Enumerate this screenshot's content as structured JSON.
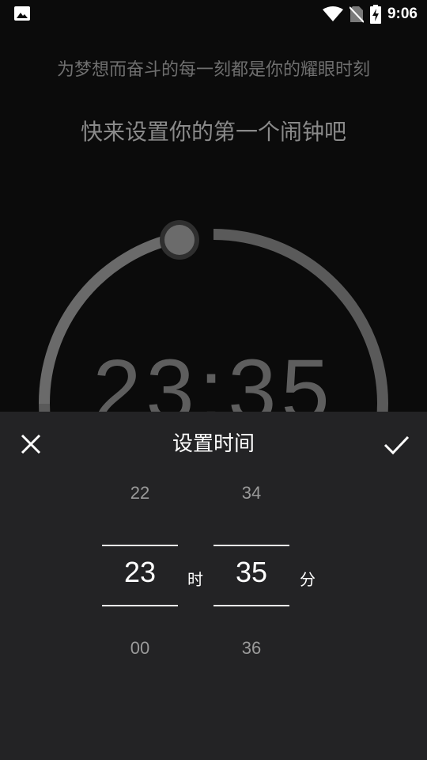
{
  "status_bar": {
    "time": "9:06",
    "icons": [
      "image-icon",
      "wifi-icon",
      "no-sim-icon",
      "battery-charging-icon"
    ]
  },
  "header": {
    "slogan": "为梦想而奋斗的每一刻都是你的耀眼时刻",
    "prompt": "快来设置你的第一个闹钟吧"
  },
  "clock_display": {
    "time": "23:35"
  },
  "time_sheet": {
    "title": "设置时间",
    "close_icon": "close-icon",
    "confirm_icon": "check-icon",
    "hour": {
      "above": "22",
      "selected": "23",
      "below": "00",
      "unit": "时"
    },
    "minute": {
      "above": "34",
      "selected": "35",
      "below": "36",
      "unit": "分"
    }
  },
  "colors": {
    "background": "#0b0b0b",
    "sheet": "#232325",
    "ring": "#5b5b5b"
  }
}
